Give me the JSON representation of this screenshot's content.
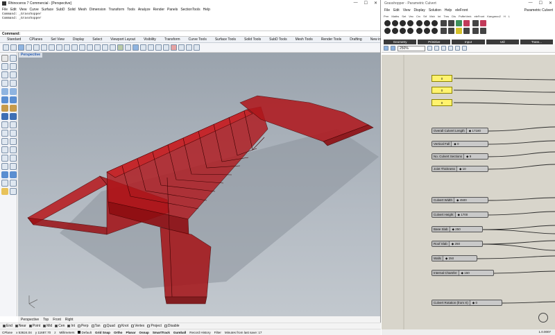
{
  "rhino": {
    "title": "Rhinoceros 7 Commercial - [Perspective]",
    "menu": [
      "File",
      "Edit",
      "View",
      "Curve",
      "Surface",
      "SubD",
      "Solid",
      "Mesh",
      "Dimension",
      "Transform",
      "Tools",
      "Analyze",
      "Render",
      "Panels",
      "SectionTools",
      "Help"
    ],
    "history": [
      "Command: _Grasshopper",
      "Command: _Grasshopper"
    ],
    "command_prompt": "Command:",
    "toolbar_tabs": [
      "Standard",
      "CPlanes",
      "Set View",
      "Display",
      "Select",
      "Viewport Layout",
      "Visibility",
      "Transform",
      "Curve Tools",
      "Surface Tools",
      "Solid Tools",
      "SubD Tools",
      "Mesh Tools",
      "Render Tools",
      "Drafting",
      "New in V7"
    ],
    "viewport_label": "Perspective",
    "view_tabs": [
      "Perspective",
      "Top",
      "Front",
      "Right"
    ],
    "osnaps": [
      {
        "label": "End",
        "on": true
      },
      {
        "label": "Near",
        "on": true
      },
      {
        "label": "Point",
        "on": true
      },
      {
        "label": "Mid",
        "on": true
      },
      {
        "label": "Cen",
        "on": true
      },
      {
        "label": "Int",
        "on": true
      },
      {
        "label": "Perp",
        "on": false
      },
      {
        "label": "Tan",
        "on": false
      },
      {
        "label": "Quad",
        "on": false
      },
      {
        "label": "Knot",
        "on": false
      },
      {
        "label": "Vertex",
        "on": false
      },
      {
        "label": "Project",
        "on": false
      },
      {
        "label": "Disable",
        "on": false
      }
    ],
    "status": {
      "cplane": "CPlane",
      "x": "x 53624.04",
      "y": "y 11687.70",
      "z": "z",
      "units": "Millimeters",
      "layer": "Default",
      "modes": [
        "Grid Snap",
        "Ortho",
        "Planar",
        "Osnap",
        "SmartTrack",
        "Gumball"
      ],
      "record": "Record History",
      "filter": "Filter",
      "message": "Minutes from last save: 17"
    }
  },
  "grasshopper": {
    "title": "Grasshopper - Parametric Culvert",
    "menu": [
      "File",
      "Edit",
      "View",
      "Display",
      "Solution",
      "Help",
      "eleFront"
    ],
    "doc_name": "Parametric Culvert",
    "tabs": [
      "Prm",
      "Maths",
      "Set",
      "Vec",
      "Crv",
      "Srf",
      "Msh",
      "Int",
      "Trns",
      "Dis",
      "PufferVerk",
      "eleFront",
      "Kangaroo2",
      "H",
      "L"
    ],
    "categories": [
      "Geometry",
      "Primitive",
      "Input",
      "Util",
      "Trans..."
    ],
    "zoom": "250%",
    "panels": [
      "0",
      "0",
      "0"
    ],
    "sliders": [
      {
        "label": "Overall Culvert Length",
        "value": "17180"
      },
      {
        "label": "Vertical Fall",
        "value": "0"
      },
      {
        "label": "No. Culvert Sections",
        "value": "9"
      },
      {
        "label": "Joint Thickness",
        "value": "10"
      },
      {
        "label": "Culvert Width",
        "value": "4500"
      },
      {
        "label": "Culvert Height",
        "value": "1700"
      },
      {
        "label": "Base Slab",
        "value": "250"
      },
      {
        "label": "Roof Slab",
        "value": "250"
      },
      {
        "label": "Walls",
        "value": "250"
      },
      {
        "label": "Internal Chamfer",
        "value": "150"
      },
      {
        "label": "Culvert Rotation (from X)",
        "value": "0"
      }
    ],
    "version": "1.0.0007"
  }
}
